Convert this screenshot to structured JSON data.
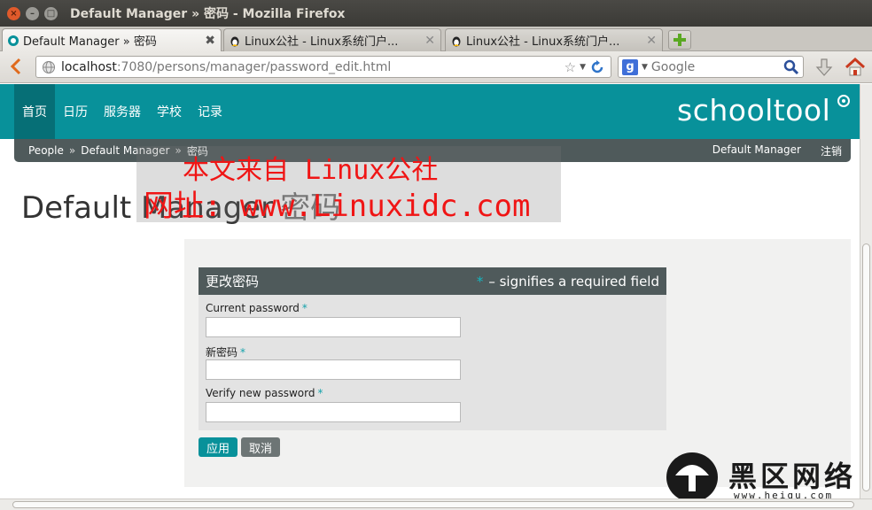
{
  "window": {
    "title": "Default Manager » 密码 - Mozilla Firefox"
  },
  "tabs": [
    {
      "label": "Default Manager » 密码"
    },
    {
      "label": "Linux公社 - Linux系统门户..."
    },
    {
      "label": "Linux公社 - Linux系统门户..."
    }
  ],
  "navbar": {
    "url_host": "localhost",
    "url_rest": ":7080/persons/manager/password_edit.html",
    "search_placeholder": "Google"
  },
  "site": {
    "nav": [
      "首页",
      "日历",
      "服务器",
      "学校",
      "记录"
    ],
    "logo": "schooltool",
    "breadcrumb": [
      "People",
      "Default Manager",
      "密码"
    ],
    "breadcrumb_sep": "»",
    "user_name": "Default Manager",
    "logout": "注销",
    "title": "Default Manager",
    "title_sub": "密码"
  },
  "form": {
    "legend": "更改密码",
    "required_marker": "*",
    "required_note": "– signifies a required field",
    "fields": [
      {
        "label": "Current password"
      },
      {
        "label": "新密码"
      },
      {
        "label": "Verify new password"
      }
    ],
    "apply": "应用",
    "cancel": "取消"
  },
  "watermark": {
    "line1": "本文来自 Linux公社",
    "line2": "网址: www.Linuxidc.com"
  },
  "corner_logo": {
    "name": "黑区网络",
    "url": "www.heiqu.com"
  },
  "colors": {
    "brand": "#08919a",
    "header_dark": "#4f5a5b",
    "watermark": "#f01515"
  }
}
